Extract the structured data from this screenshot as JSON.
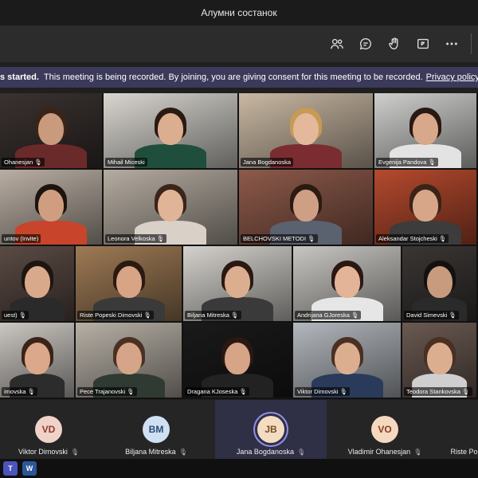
{
  "window": {
    "title": "Алумни состанок"
  },
  "toolbar": {
    "icons": [
      "participants-icon",
      "chat-icon",
      "raise-hand-icon",
      "share-icon",
      "more-icon"
    ]
  },
  "banner": {
    "started": "s started.",
    "message": "This meeting is being recorded. By joining, you are giving consent for this meeting to be recorded.",
    "link": "Privacy policy"
  },
  "grid": [
    {
      "name": "Ohanesjan 🎙",
      "bg": "#3a3230",
      "skin": "#c99a7c",
      "hair": "#3a2418",
      "shirt": "#6b2a2a"
    },
    {
      "name": "Mihail Miceski",
      "bg": "#d9d6d0",
      "skin": "#dcae90",
      "hair": "#2a1a12",
      "shirt": "#1f4f3c"
    },
    {
      "name": "Jana Bogdanoska",
      "bg": "#c9b8a3",
      "skin": "#e4b89b",
      "hair": "#c79a55",
      "shirt": "#7a2c31"
    },
    {
      "name": "Evgenija Pandova 🎙",
      "bg": "#cfcfcd",
      "skin": "#d7a889",
      "hair": "#2a1812",
      "shirt": "#e3e3e3"
    },
    {
      "name": "untov (Invite)",
      "bg": "#b9aea3",
      "skin": "#cf9e81",
      "hair": "#1e140f",
      "shirt": "#c8442a"
    },
    {
      "name": "Leonora Velkoska 🎙",
      "bg": "#b5aca1",
      "skin": "#e0b497",
      "hair": "#3b2419",
      "shirt": "#d9d0c8"
    },
    {
      "name": "BELCHOVSKI METODI 🎙",
      "bg": "#8d5a4a",
      "skin": "#cf9f85",
      "hair": "#2a1a12",
      "shirt": "#5a6270"
    },
    {
      "name": "Aleksandar Stojcheski 🎙",
      "bg": "#b54a2e",
      "skin": "#d7a688",
      "hair": "#3a2418",
      "shirt": "#3c3c3c"
    },
    {
      "name": "uest) 🎙",
      "bg": "#5a4a44",
      "skin": "#d9a98b",
      "hair": "#1e1410",
      "shirt": "#2a2a2a"
    },
    {
      "name": "Riste Popeski Dimovski 🎙",
      "bg": "#9e7a55",
      "skin": "#d8a486",
      "hair": "#2a1a12",
      "shirt": "#3a3a3a"
    },
    {
      "name": "Biljana Mitreska 🎙",
      "bg": "#d5d2cd",
      "skin": "#dcae90",
      "hair": "#2a1812",
      "shirt": "#3a3a3a"
    },
    {
      "name": "Andrijana GJoreska 🎙",
      "bg": "#c8c6c2",
      "skin": "#e3b497",
      "hair": "#2a1812",
      "shirt": "#e6e6e6"
    },
    {
      "name": "David Simevski 🎙",
      "bg": "#3a3634",
      "skin": "#c89a7e",
      "hair": "#151010",
      "shirt": "#2a2a2a"
    },
    {
      "name": "imovska 🎙",
      "bg": "#cbc7c2",
      "skin": "#dba88b",
      "hair": "#3a2418",
      "shirt": "#2c2c2c"
    },
    {
      "name": "Pece Trajanovski 🎙",
      "bg": "#b7b0a6",
      "skin": "#d6a488",
      "hair": "#4a3022",
      "shirt": "#2f3a33"
    },
    {
      "name": "Dragana KJoseska 🎙",
      "bg": "#1a1a1a",
      "skin": "#d6a487",
      "hair": "#2a1812",
      "shirt": "#222"
    },
    {
      "name": "Viktor Dimovski 🎙",
      "bg": "#b3b8be",
      "skin": "#dcae90",
      "hair": "#4a3022",
      "shirt": "#2a3a5a"
    },
    {
      "name": "Teodora Stankovska 🎙",
      "bg": "#6a5a52",
      "skin": "#dcae90",
      "hair": "#4a3022",
      "shirt": "#cfcfcf"
    }
  ],
  "participants": [
    {
      "initials": "VD",
      "name": "Viktor Dimovski",
      "avatar_bg": "#f0d2c8",
      "avatar_fg": "#8c3a2a",
      "active": false
    },
    {
      "initials": "BM",
      "name": "Biljana Mitreska",
      "avatar_bg": "#cfe0f3",
      "avatar_fg": "#2a4a75",
      "active": false
    },
    {
      "initials": "JB",
      "name": "Jana Bogdanoska",
      "avatar_bg": "#f3dcc2",
      "avatar_fg": "#7a4a22",
      "active": true
    },
    {
      "initials": "VO",
      "name": "Vladimir Ohanesjan",
      "avatar_bg": "#f5d8c0",
      "avatar_fg": "#8a3a1f",
      "active": false
    },
    {
      "initials": "",
      "name": "Riste Pop",
      "avatar_bg": "#262526",
      "avatar_fg": "#fff",
      "active": false
    }
  ],
  "taskbar": {
    "apps": [
      "T",
      "W"
    ]
  }
}
